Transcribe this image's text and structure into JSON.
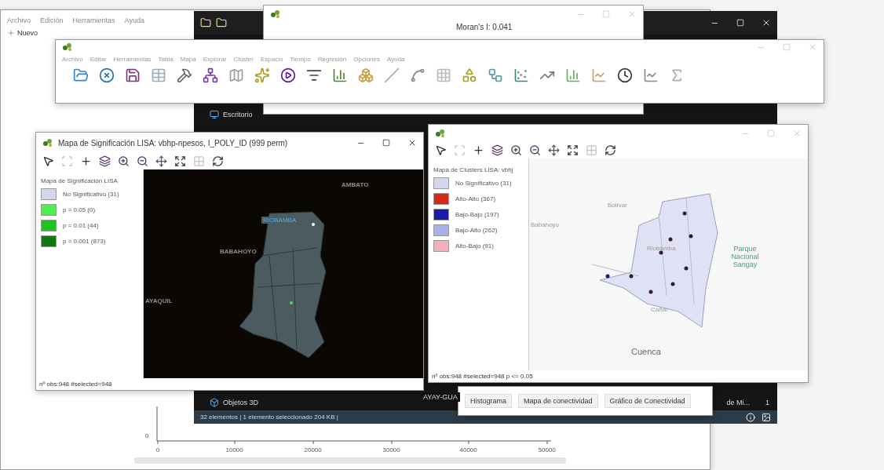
{
  "main_window": {
    "menu": [
      "Archivo",
      "Edición",
      "Herramientas",
      "Ayuda"
    ],
    "new_button": "Nuevo",
    "plot": {
      "y_tick": "0",
      "x_ticks": [
        "0",
        "10000",
        "20000",
        "30000",
        "40000",
        "50000"
      ]
    }
  },
  "explorer": {
    "items": [
      {
        "label": "Escritorio"
      },
      {
        "label": "Objetos 3D"
      }
    ],
    "status": "32 elementos  |  1 elemento seleccionado  204 KB  |",
    "column_text": "AYAY-GUA",
    "right_cell": "de Mi...",
    "count": "1"
  },
  "moran_window": {
    "statistic": "Moran's I: 0.041"
  },
  "geoda_window": {
    "menu": [
      "Archivo",
      "Editar",
      "Herramientas",
      "Tabla",
      "Mapa",
      "Explorar",
      "Clúster",
      "Espacio",
      "Tiempo",
      "Regresión",
      "Opciones",
      "Ayuda"
    ]
  },
  "significance_map": {
    "title": "Mapa de Significación LISA: vbhp-npesos, I_POLY_ID (999 perm)",
    "legend_title": "Mapa de Significación LISA",
    "legend": [
      {
        "label": "No Significativo (31)",
        "color": "#d4d6ee"
      },
      {
        "label": "p = 0.05 (0)",
        "color": "#4cf04c"
      },
      {
        "label": "p = 0.01 (44)",
        "color": "#1ec41e"
      },
      {
        "label": "p = 0.001 (873)",
        "color": "#0e7a0e"
      }
    ],
    "places": [
      {
        "name": "AMBATO",
        "kind": "city"
      },
      {
        "name": "BABAHOYO",
        "kind": "city"
      },
      {
        "name": "RIOBAMBA",
        "kind": "capital"
      },
      {
        "name": "AYAQUIL",
        "kind": "city"
      }
    ],
    "status": "nº obs:948 #selected=948"
  },
  "cluster_map": {
    "legend_title": "Mapa de Clusters LISA: vbhj",
    "legend": [
      {
        "label": "No Significativo (31)",
        "color": "#d4d6ee"
      },
      {
        "label": "Alto-Alto (367)",
        "color": "#d42a1a"
      },
      {
        "label": "Bajo-Bajo (197)",
        "color": "#1a1aa8"
      },
      {
        "label": "Bajo-Alto (262)",
        "color": "#a8b0e8"
      },
      {
        "label": "Alto-Bajo (91)",
        "color": "#f0b0bc"
      }
    ],
    "places": [
      {
        "name": "Bolívar",
        "kind": "town"
      },
      {
        "name": "Babahoyo",
        "kind": "town"
      },
      {
        "name": "Riobamba",
        "kind": "town"
      },
      {
        "name": "Parque Nacional Sangay",
        "kind": "park"
      },
      {
        "name": "Cañar",
        "kind": "town"
      },
      {
        "name": "Cuenca",
        "kind": "city"
      }
    ],
    "status": "nº obs:948 #selected=948   p <= 0.05"
  },
  "popup": {
    "buttons": [
      "Histograma",
      "Mapa de conectividad",
      "Gráfico de Conectividad"
    ]
  }
}
